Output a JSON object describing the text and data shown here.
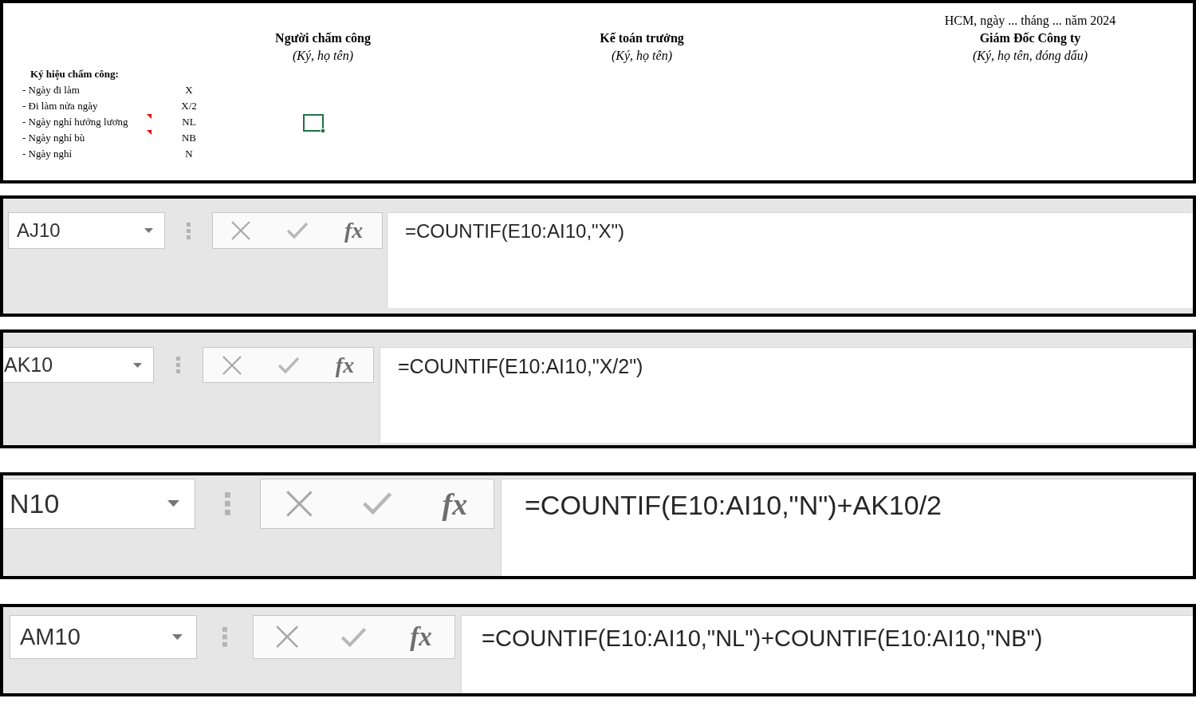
{
  "sheet": {
    "signatories": [
      {
        "title": "Người chấm công",
        "note": "(Ký, họ tên)"
      },
      {
        "title": "Kế toán trưởng",
        "note": "(Ký, họ tên)"
      },
      {
        "date_line": "HCM, ngày ... tháng ... năm 2024",
        "title": "Giám Đốc Công ty",
        "note": "(Ký, họ tên, đóng dấu)"
      }
    ],
    "legend": {
      "title": "Ký hiệu chấm công:",
      "items": [
        {
          "label": "- Ngày đi làm",
          "code": "X",
          "has_comment": false
        },
        {
          "label": "- Đi làm nửa ngày",
          "code": "X/2",
          "has_comment": false
        },
        {
          "label": "- Ngày nghỉ hưởng lương",
          "code": "NL",
          "has_comment": true
        },
        {
          "label": "- Ngày nghỉ bù",
          "code": "NB",
          "has_comment": true
        },
        {
          "label": "- Ngày nghỉ",
          "code": "N",
          "has_comment": false
        }
      ]
    },
    "active_cell_shown": true
  },
  "formula_bars": [
    {
      "name_box": "AJ10",
      "function_button": "fx",
      "formula": "=COUNTIF(E10:AI10,\"X\")"
    },
    {
      "name_box": "AK10",
      "function_button": "fx",
      "formula": "=COUNTIF(E10:AI10,\"X/2\")"
    },
    {
      "name_box": "N10",
      "function_button": "fx",
      "formula": "=COUNTIF(E10:AI10,\"N\")+AK10/2"
    },
    {
      "name_box": "AM10",
      "function_button": "fx",
      "formula": "=COUNTIF(E10:AI10,\"NL\")+COUNTIF(E10:AI10,\"NB\")"
    }
  ]
}
